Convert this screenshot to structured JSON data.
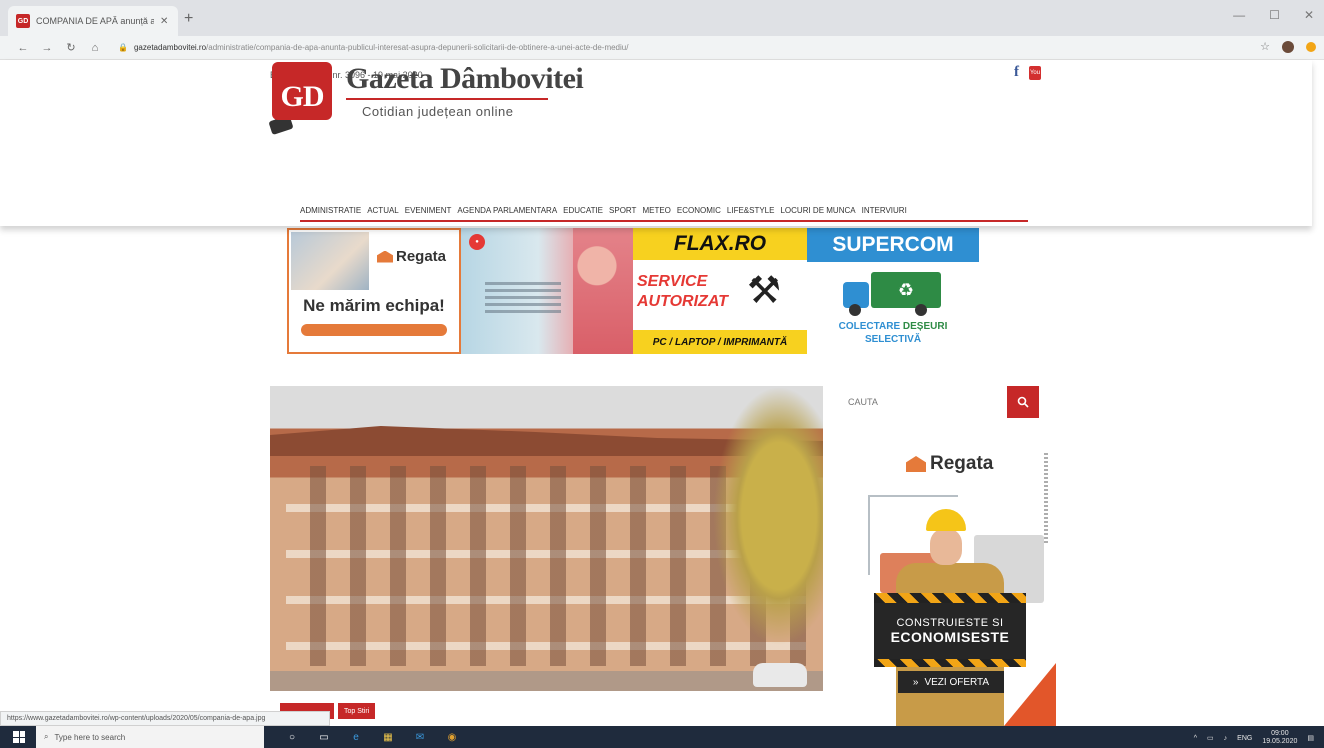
{
  "browser": {
    "tab_title": "COMPANIA DE APĂ anunță auti",
    "tab_favicon": "GD",
    "url_domain": "gazetadambovitei.ro",
    "url_path": "/administratie/compania-de-apa-anunta-publicul-interesat-asupra-depunerii-solicitarii-de-obtinere-a-unei-acte-de-mediu/"
  },
  "header": {
    "edition": "Ediția de marți, nr. 3096 - 19 mai 2020",
    "logo_letters": "GD",
    "site_title": "Gazeta Dâmbovitei",
    "tagline": "Cotidian județean online",
    "social": {
      "facebook": "f",
      "youtube": "You"
    }
  },
  "nav": {
    "items": [
      "ADMINISTRATIE",
      "ACTUAL",
      "EVENIMENT",
      "AGENDA PARLAMENTARA",
      "EDUCATIE",
      "SPORT",
      "METEO",
      "ECONOMIC",
      "LIFE&STYLE",
      "LOCURI DE MUNCA",
      "INTERVIURI"
    ]
  },
  "banners": {
    "regata": {
      "name": "Regata",
      "headline": "Ne mărim echipa!"
    },
    "flax": {
      "brand": "FLAX.RO",
      "line1": "SERVICE",
      "line2": "AUTORIZAT",
      "footer": "PC / LAPTOP / IMPRIMANTĂ"
    },
    "supercom": {
      "brand": "SUPERCOM",
      "line1a": "COLECTARE ",
      "line1b": "DEȘEURI",
      "line2": "SELECTIVĂ"
    }
  },
  "article": {
    "tags": [
      "",
      "Top Stiri"
    ]
  },
  "sidebar": {
    "search_placeholder": "CAUTA",
    "ad": {
      "brand": "Regata",
      "line1": "CONSTRUIESTE SI",
      "line2": "ECONOMISESTE",
      "cta": "VEZI OFERTA"
    }
  },
  "statusbar": {
    "url": "https://www.gazetadambovitei.ro/wp-content/uploads/2020/05/compania-de-apa.jpg"
  },
  "taskbar": {
    "search_placeholder": "Type here to search",
    "lang": "ENG",
    "time": "09:00",
    "date": "19.05.2020"
  },
  "colors": {
    "brand_red": "#c62828",
    "regata_orange": "#e57a3a",
    "flax_yellow": "#f7d11f",
    "supercom_blue": "#2f8fd2"
  }
}
